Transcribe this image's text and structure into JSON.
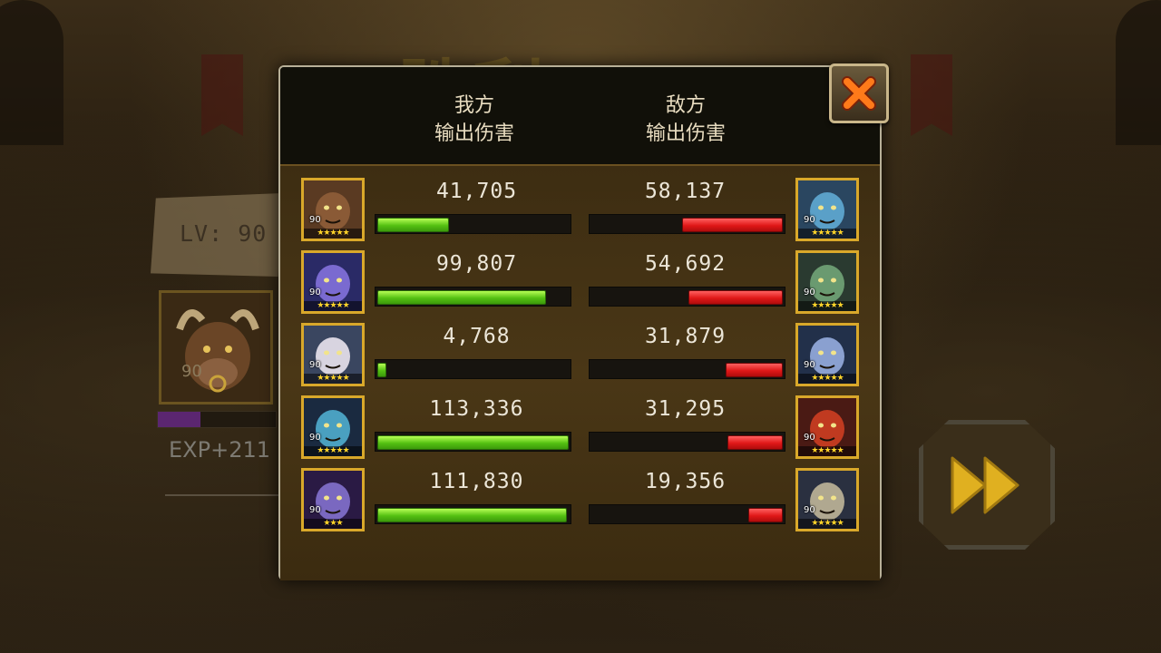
{
  "background": {
    "title_glyphs": "胜利",
    "level_label": "LV: 90",
    "hero_level": "90",
    "exp_label": "EXP+211",
    "exp_progress": 0.36
  },
  "dialog": {
    "our_header_line1": "我方",
    "our_header_line2": "输出伤害",
    "enemy_header_line1": "敌方",
    "enemy_header_line2": "输出伤害",
    "close_icon": "close-x-icon",
    "rows": [
      {
        "our_level": "90",
        "our_stars": "★★★★★",
        "our_damage": "41,705",
        "our_ratio": 0.37,
        "enemy_level": "90",
        "enemy_stars": "★★★★★",
        "enemy_damage": "58,137",
        "enemy_ratio": 0.52
      },
      {
        "our_level": "90",
        "our_stars": "★★★★★",
        "our_damage": "99,807",
        "our_ratio": 0.88,
        "enemy_level": "90",
        "enemy_stars": "★★★★★",
        "enemy_damage": "54,692",
        "enemy_ratio": 0.49
      },
      {
        "our_level": "90",
        "our_stars": "★★★★★",
        "our_damage": "4,768",
        "our_ratio": 0.04,
        "enemy_level": "90",
        "enemy_stars": "★★★★★",
        "enemy_damage": "31,879",
        "enemy_ratio": 0.29
      },
      {
        "our_level": "90",
        "our_stars": "★★★★★",
        "our_damage": "113,336",
        "our_ratio": 1.0,
        "enemy_level": "90",
        "enemy_stars": "★★★★★",
        "enemy_damage": "31,295",
        "enemy_ratio": 0.28
      },
      {
        "our_level": "90",
        "our_stars": "★★★",
        "our_damage": "111,830",
        "our_ratio": 0.99,
        "enemy_level": "90",
        "enemy_stars": "★★★★★",
        "enemy_damage": "19,356",
        "enemy_ratio": 0.17
      }
    ]
  },
  "fast_forward_icon": "fast-forward-icon",
  "colors": {
    "our_bar": "#54c012",
    "enemy_bar": "#e01818",
    "frame_gold": "#d9a82a"
  }
}
